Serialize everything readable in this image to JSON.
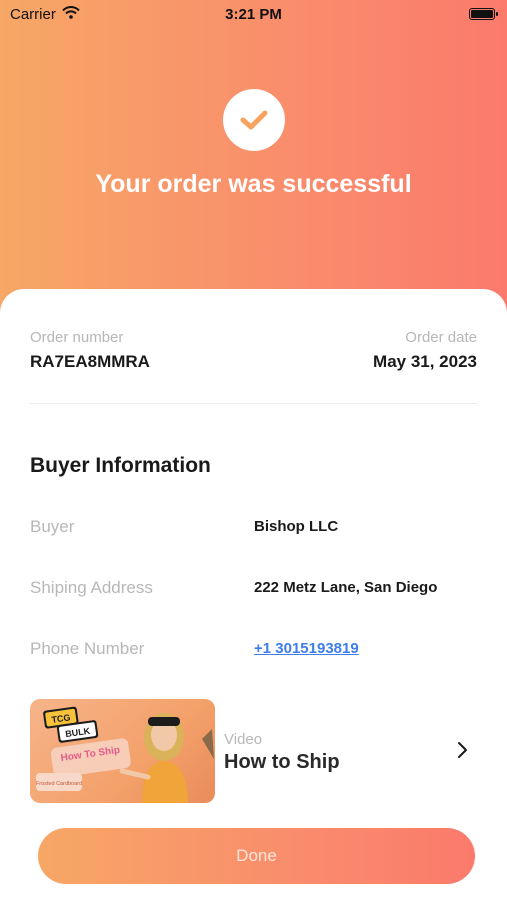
{
  "status_bar": {
    "carrier": "Carrier",
    "time": "3:21 PM"
  },
  "hero": {
    "title": "Your order was successful"
  },
  "order": {
    "number_label": "Order number",
    "number": "RA7EA8MMRA",
    "date_label": "Order date",
    "date": "May 31, 2023"
  },
  "buyer_info": {
    "title": "Buyer Information",
    "rows": [
      {
        "label": "Buyer",
        "value": "Bishop LLC"
      },
      {
        "label": "Shiping Address",
        "value": "222 Metz Lane, San Diego"
      },
      {
        "label": "Phone Number",
        "value": "+1 3015193819"
      }
    ]
  },
  "video": {
    "label": "Video",
    "title": "How to Ship",
    "thumbnail": {
      "badge1": "TCG",
      "badge2": "BULK",
      "caption": "How To Ship",
      "brand": "Frosted Cardboard"
    }
  },
  "done_label": "Done",
  "colors": {
    "gradient_start": "#f7a766",
    "gradient_end": "#fb7a6c",
    "link": "#3e7ee8"
  }
}
